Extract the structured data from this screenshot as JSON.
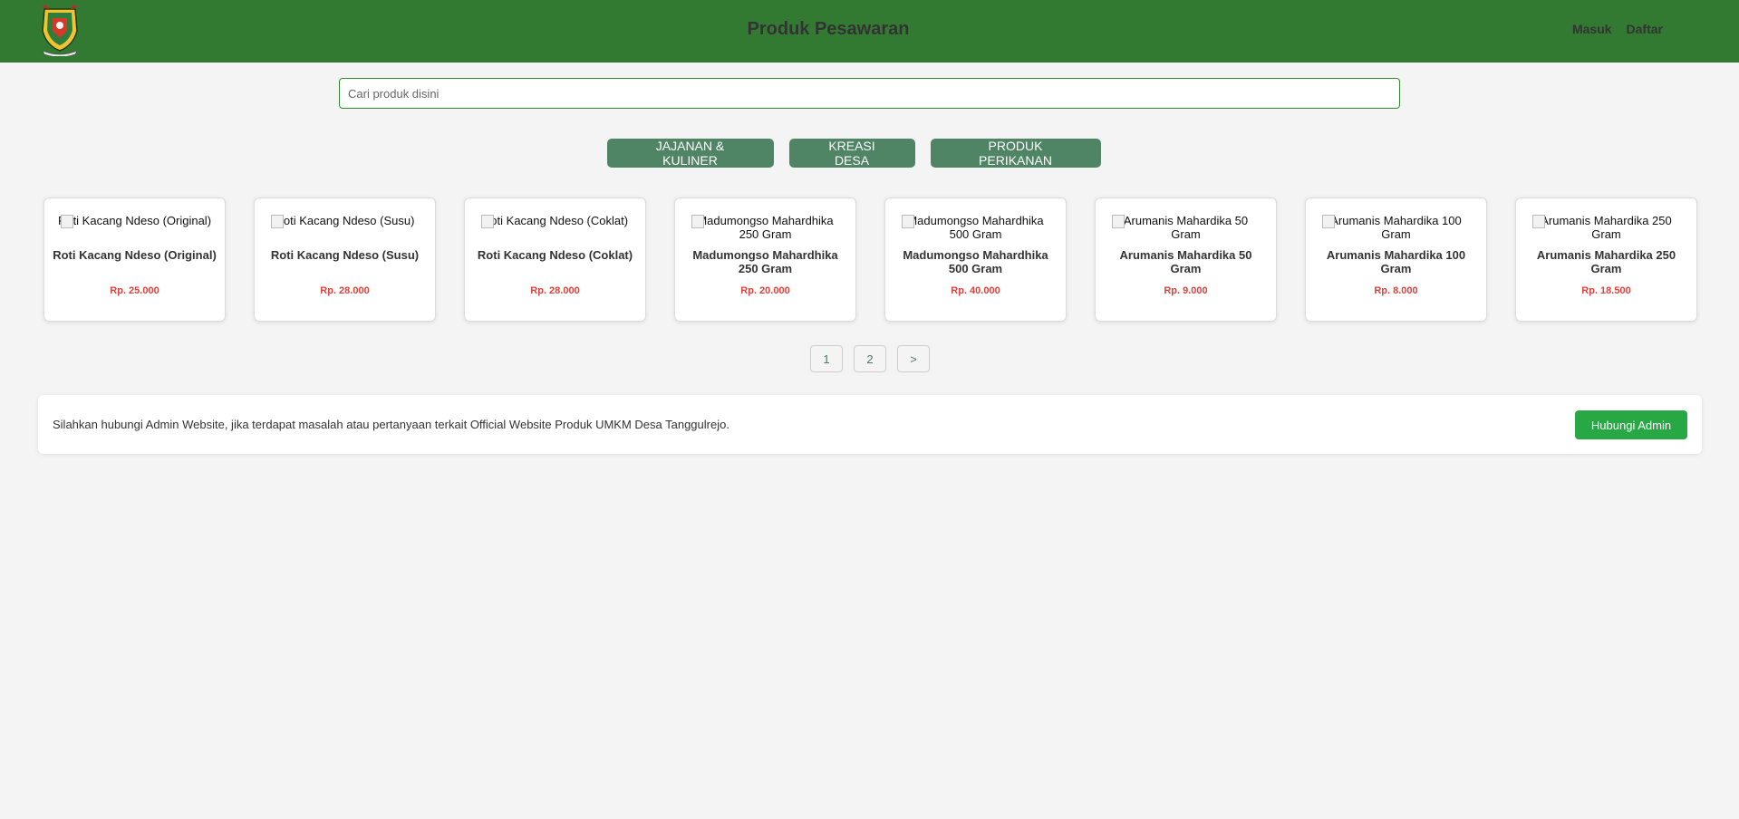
{
  "header": {
    "title": "Produk Pesawaran",
    "nav": [
      "Masuk",
      "Daftar"
    ]
  },
  "search": {
    "placeholder": "Cari produk disini",
    "value": ""
  },
  "categories": [
    "JAJANAN & KULINER",
    "KREASI DESA",
    "PRODUK PERIKANAN"
  ],
  "products": [
    {
      "name": "Roti Kacang Ndeso (Original)",
      "price": "Rp. 25.000"
    },
    {
      "name": "Roti Kacang Ndeso (Susu)",
      "price": "Rp. 28.000"
    },
    {
      "name": "Roti Kacang Ndeso (Coklat)",
      "price": "Rp. 28.000"
    },
    {
      "name": "Madumongso Mahardhika 250 Gram",
      "price": "Rp. 20.000"
    },
    {
      "name": "Madumongso Mahardhika 500 Gram",
      "price": "Rp. 40.000"
    },
    {
      "name": "Arumanis Mahardika 50 Gram",
      "price": "Rp. 9.000"
    },
    {
      "name": "Arumanis Mahardika 100 Gram",
      "price": "Rp. 8.000"
    },
    {
      "name": "Arumanis Mahardika 250 Gram",
      "price": "Rp. 18.500"
    }
  ],
  "pagination": [
    "1",
    "2",
    ">"
  ],
  "contact": {
    "text": "Silahkan hubungi Admin Website, jika terdapat masalah atau pertanyaan terkait Official Website Produk UMKM Desa Tanggulrejo.",
    "button": "Hubungi Admin"
  },
  "colors": {
    "header": "#327a32",
    "category_button": "#4f8464",
    "price": "#e0403a",
    "contact_button": "#28a745"
  },
  "icons": {
    "logo": "regency-emblem-logo"
  }
}
